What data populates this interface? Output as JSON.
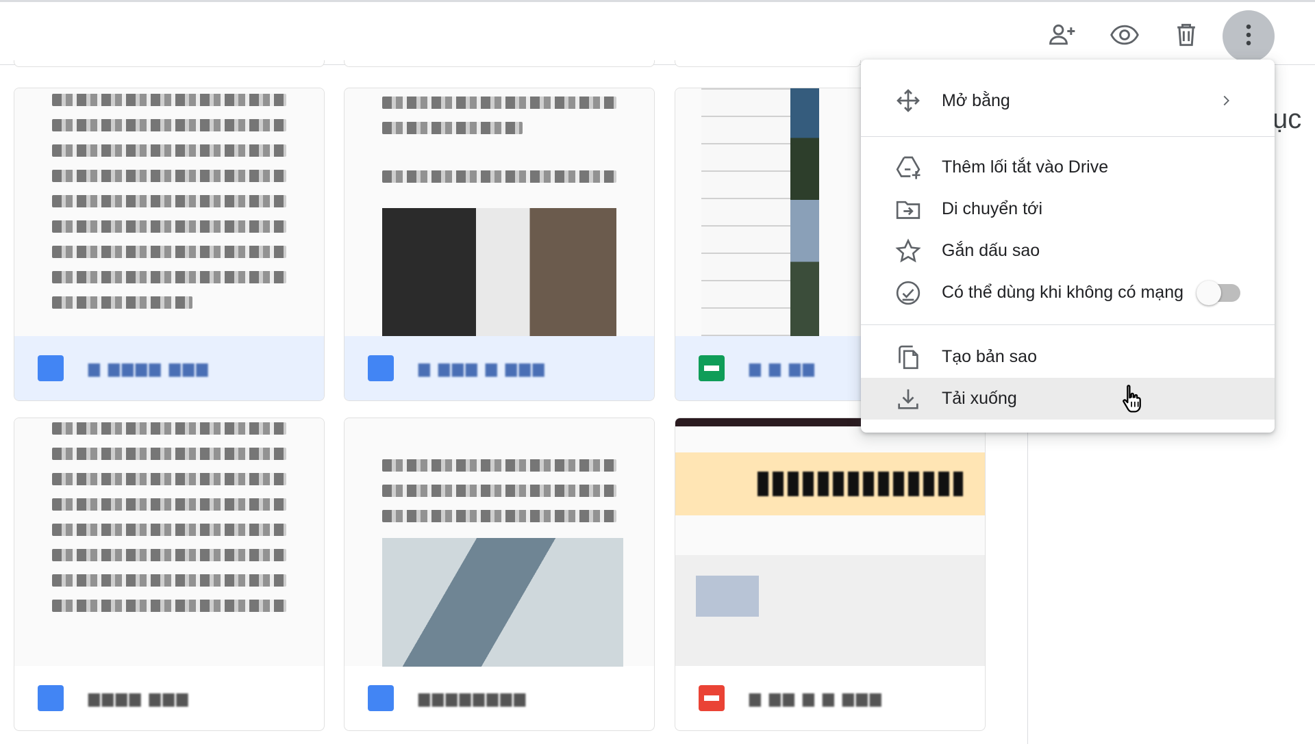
{
  "toolbar": {
    "buttons": [
      {
        "name": "share",
        "icon": "person-add-icon"
      },
      {
        "name": "preview",
        "icon": "eye-icon"
      },
      {
        "name": "delete",
        "icon": "trash-icon"
      },
      {
        "name": "more-actions",
        "icon": "more-vert-icon"
      }
    ]
  },
  "side_panel": {
    "partial_text": "ục"
  },
  "files": [
    {
      "type": "doc",
      "icon": "docs-icon",
      "name": "▆ ▆▆▆▆ ▆▆▆",
      "selected": true
    },
    {
      "type": "doc",
      "icon": "docs-icon",
      "name": "▆ ▆▆▆ ▆   ▆▆▆",
      "selected": true
    },
    {
      "type": "sheet",
      "icon": "sheets-icon",
      "name": "▆ ▆ ▆▆",
      "selected": true
    },
    {
      "type": "doc",
      "icon": "docs-icon",
      "name": "▆▆▆▆ ▆▆▆",
      "selected": false
    },
    {
      "type": "doc",
      "icon": "docs-icon",
      "name": "▆▆▆▆▆▆▆▆",
      "selected": false
    },
    {
      "type": "pdf",
      "icon": "pdf-icon",
      "name": "▆ ▆▆  ▆ ▆ ▆▆▆",
      "selected": false
    }
  ],
  "menu": {
    "open_with": {
      "label": "Mở bằng",
      "icon": "open-with-icon"
    },
    "add_shortcut": {
      "label": "Thêm lối tắt vào Drive",
      "icon": "add-shortcut-icon"
    },
    "move_to": {
      "label": "Di chuyển tới",
      "icon": "move-to-folder-icon"
    },
    "star": {
      "label": "Gắn dấu sao",
      "icon": "star-icon"
    },
    "offline": {
      "label": "Có thể dùng khi không có mạng",
      "icon": "offline-check-icon",
      "enabled": false
    },
    "make_copy": {
      "label": "Tạo bản sao",
      "icon": "copy-icon"
    },
    "download": {
      "label": "Tải xuống",
      "icon": "download-icon",
      "hovered": true
    }
  },
  "colors": {
    "doc": "#4285f4",
    "sheet": "#0f9d58",
    "pdf": "#ea4335",
    "selected_bg": "#e8f0fe",
    "menu_hover": "#ebebeb"
  }
}
